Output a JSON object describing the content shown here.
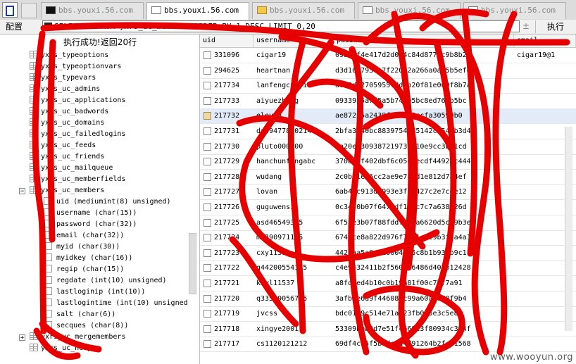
{
  "tabs": [
    {
      "label": "bbs.youxi.56.com",
      "icon": "console-icon",
      "active": false
    },
    {
      "label": "bbs.youxi.56.com",
      "icon": "document-icon",
      "active": true
    },
    {
      "label": "bbs.youxi.56.com",
      "icon": "folder-icon",
      "active": false
    },
    {
      "label": "bbs.youxi.56.com",
      "icon": "document-icon",
      "active": false
    },
    {
      "label": "bbs.youxi.56.com",
      "icon": "document-icon",
      "active": false
    }
  ],
  "toolbar": {
    "config_label": "配置",
    "query_value": "SELECT * FROM yxrs_uc_members  ORDER BY 1 DESC LIMIT 0,20",
    "execute_label": "执行",
    "adjust_glyph": "±"
  },
  "status_text": "执行成功!返回20行",
  "tree": [
    {
      "label": "yxrs_typeoptions",
      "kind": "table"
    },
    {
      "label": "yxrs_typeoptionvars",
      "kind": "table"
    },
    {
      "label": "yxrs_typevars",
      "kind": "table"
    },
    {
      "label": "yxrs_uc_admins",
      "kind": "table"
    },
    {
      "label": "yxrs_uc_applications",
      "kind": "table"
    },
    {
      "label": "yxrs_uc_badwords",
      "kind": "table"
    },
    {
      "label": "yxrs_uc_domains",
      "kind": "table"
    },
    {
      "label": "yxrs_uc_failedlogins",
      "kind": "table"
    },
    {
      "label": "yxrs_uc_feeds",
      "kind": "table"
    },
    {
      "label": "yxrs_uc_friends",
      "kind": "table"
    },
    {
      "label": "yxrs_uc_mailqueue",
      "kind": "table"
    },
    {
      "label": "yxrs_uc_memberfields",
      "kind": "table"
    },
    {
      "label": "yxrs_uc_members",
      "kind": "table",
      "expander": "−"
    },
    {
      "label": "uid (mediumint(8) unsigned)",
      "kind": "column"
    },
    {
      "label": "username (char(15))",
      "kind": "column"
    },
    {
      "label": "password (char(32))",
      "kind": "column"
    },
    {
      "label": "email (char(32))",
      "kind": "column"
    },
    {
      "label": "myid (char(30))",
      "kind": "column"
    },
    {
      "label": "myidkey (char(16))",
      "kind": "column"
    },
    {
      "label": "regip (char(15))",
      "kind": "column"
    },
    {
      "label": "regdate (int(10) unsigned)",
      "kind": "column"
    },
    {
      "label": "lastloginip (int(10))",
      "kind": "column"
    },
    {
      "label": "lastlogintime (int(10) unsigned",
      "kind": "column"
    },
    {
      "label": "salt (char(6))",
      "kind": "column"
    },
    {
      "label": "secques (char(8))",
      "kind": "column"
    },
    {
      "label": "yxrs_uc_mergemembers",
      "kind": "table",
      "expander": "+"
    },
    {
      "label": "yxrs_uc_newpm",
      "kind": "table"
    }
  ],
  "grid": {
    "columns": [
      "uid",
      "username",
      "password",
      "email"
    ],
    "rows": [
      {
        "uid": "331096",
        "username": "cigar19",
        "password": "09ae6f4e417d2d0b4c84d8774c9b8b2e",
        "email": "cigar19@1"
      },
      {
        "uid": "294625",
        "username": "heartnan",
        "password": "d3d101793fa7f220c2a266a0a65b5efd",
        "email": ""
      },
      {
        "uid": "217734",
        "username": "lanfengcuiji",
        "password": "a0c2d32705955fddab20f81e000f8b7a",
        "email": ""
      },
      {
        "uid": "217733",
        "username": "aiyuezheng",
        "password": "09339a5a7f5a5b741e5bc8ed765b5bc",
        "email": ""
      },
      {
        "uid": "217732",
        "username": "eleven",
        "password": "ae872c5a2438f353a62ccfa30590b0",
        "email": "",
        "selected": true
      },
      {
        "uid": "217731",
        "username": "dz39477890214",
        "password": "2bfa3840bc8839754865142c4543b3d4",
        "email": ""
      },
      {
        "uid": "217730",
        "username": "pluto000000",
        "password": "8a20e9309387219732210e9cc3bd1cd",
        "email": ""
      },
      {
        "uid": "217729",
        "username": "hanchunfengabc",
        "password": "370896f402dbf6c05e1ecdf44927c444",
        "email": ""
      },
      {
        "uid": "217728",
        "username": "wudang",
        "password": "2c0b51e76cc2ae9e783d1e812d7a4ef",
        "email": ""
      },
      {
        "uid": "217727",
        "username": "lovan",
        "password": "6ab4bc913d8993e3fd8427c2e7cde12",
        "email": ""
      },
      {
        "uid": "217726",
        "username": "guguwensi",
        "password": "0c3470b07f6472df109c7c7a638a26d",
        "email": ""
      },
      {
        "uid": "217725",
        "username": "asd46549355",
        "password": "6f57e3b07f88fddfcc8a6620d5c09b3e",
        "email": ""
      },
      {
        "uid": "217724",
        "username": "m5390971195",
        "password": "6746ce8a822d976f7fb1e5c9b3f3a4a1",
        "email": ""
      },
      {
        "uid": "217723",
        "username": "cxy11311",
        "password": "4424aa5a0a5200046d5c8b1b937b9c11",
        "email": ""
      },
      {
        "uid": "217722",
        "username": "g44200554165",
        "password": "c4e9432411b2f5600b6486d402b12428",
        "email": ""
      },
      {
        "uid": "217721",
        "username": "kkyl11537",
        "password": "a8fdced4b10c0b19a81f00c7bf7a91",
        "email": ""
      },
      {
        "uid": "217720",
        "username": "q33599056785",
        "password": "3afb0e6d9f446085c99a60a8670f9b4",
        "email": ""
      },
      {
        "uid": "217719",
        "username": "jvcss",
        "password": "bdc01d9c514e71ad23fb025e3c5e88",
        "email": ""
      },
      {
        "uid": "217718",
        "username": "xingye2001",
        "password": "53309bbb3d7e51f4668e3f80934c324f",
        "email": ""
      },
      {
        "uid": "217717",
        "username": "cs1120121212",
        "password": "69df4ca5f5b1dc2d4d91264b2fc41568",
        "email": ""
      }
    ]
  },
  "watermark": "www.wooyun.org",
  "colors": {
    "scribble": "#e60000",
    "selected_row": "#e2ebf7",
    "tab_bar": "#dcdcdc"
  }
}
